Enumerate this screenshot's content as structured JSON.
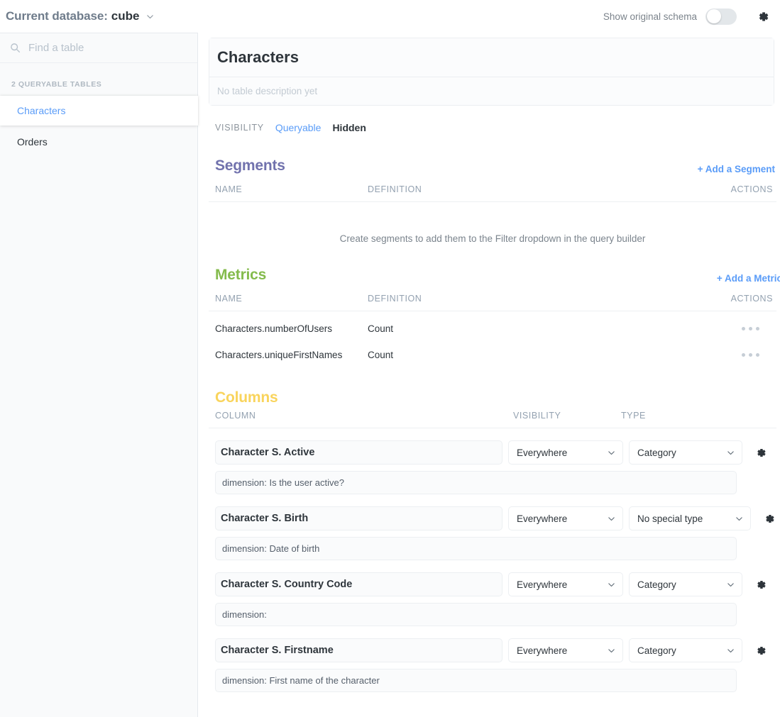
{
  "topbar": {
    "db_prefix": "Current database:",
    "db_name": "cube",
    "caret_icon": "chevron-down-icon",
    "show_original_schema_label": "Show original schema",
    "toggle_state": "off",
    "settings_icon": "gear-icon"
  },
  "sidebar": {
    "search_placeholder": "Find a table",
    "search_icon": "search-icon",
    "tables_header": "2 QUERYABLE TABLES",
    "items": [
      {
        "label": "Characters",
        "selected": true
      },
      {
        "label": "Orders",
        "selected": false
      }
    ]
  },
  "table_header": {
    "title": "Characters",
    "description_placeholder": "No table description yet",
    "visibility_label": "VISIBILITY",
    "visibility_options": [
      {
        "label": "Queryable",
        "active": true
      },
      {
        "label": "Hidden",
        "active": false
      }
    ]
  },
  "segments": {
    "title": "Segments",
    "add_link": "+ Add a Segment",
    "columns": [
      "NAME",
      "DEFINITION",
      "ACTIONS"
    ],
    "empty_message": "Create segments to add them to the Filter dropdown in the query builder",
    "rows": []
  },
  "metrics": {
    "title": "Metrics",
    "add_link": "+ Add a Metric",
    "columns": [
      "NAME",
      "DEFINITION",
      "ACTIONS"
    ],
    "rows": [
      {
        "name": "Characters.numberOfUsers",
        "definition": "Count",
        "actions_icon": "ellipsis-icon"
      },
      {
        "name": "Characters.uniqueFirstNames",
        "definition": "Count",
        "actions_icon": "ellipsis-icon"
      }
    ]
  },
  "columns_section": {
    "title": "Columns",
    "columns": [
      "COLUMN",
      "VISIBILITY",
      "TYPE"
    ],
    "rows": [
      {
        "name": "Character S. Active",
        "visibility": "Everywhere",
        "type": "Category",
        "description": "dimension: Is the user active?",
        "settings_icon": "gear-icon"
      },
      {
        "name": "Character S. Birth",
        "visibility": "Everywhere",
        "type": "No special type",
        "description": "dimension: Date of birth",
        "settings_icon": "gear-icon"
      },
      {
        "name": "Character S. Country Code",
        "visibility": "Everywhere",
        "type": "Category",
        "description": "dimension:",
        "settings_icon": "gear-icon"
      },
      {
        "name": "Character S. Firstname",
        "visibility": "Everywhere",
        "type": "Category",
        "description": "dimension: First name of the character",
        "settings_icon": "gear-icon"
      }
    ]
  },
  "colors": {
    "accent_blue": "#5a9cf8",
    "segments_purple": "#7172ad",
    "metrics_green": "#84bb4c",
    "columns_yellow": "#f9d45c",
    "text_dark": "#2e353b",
    "text_muted": "#93a1b0"
  }
}
